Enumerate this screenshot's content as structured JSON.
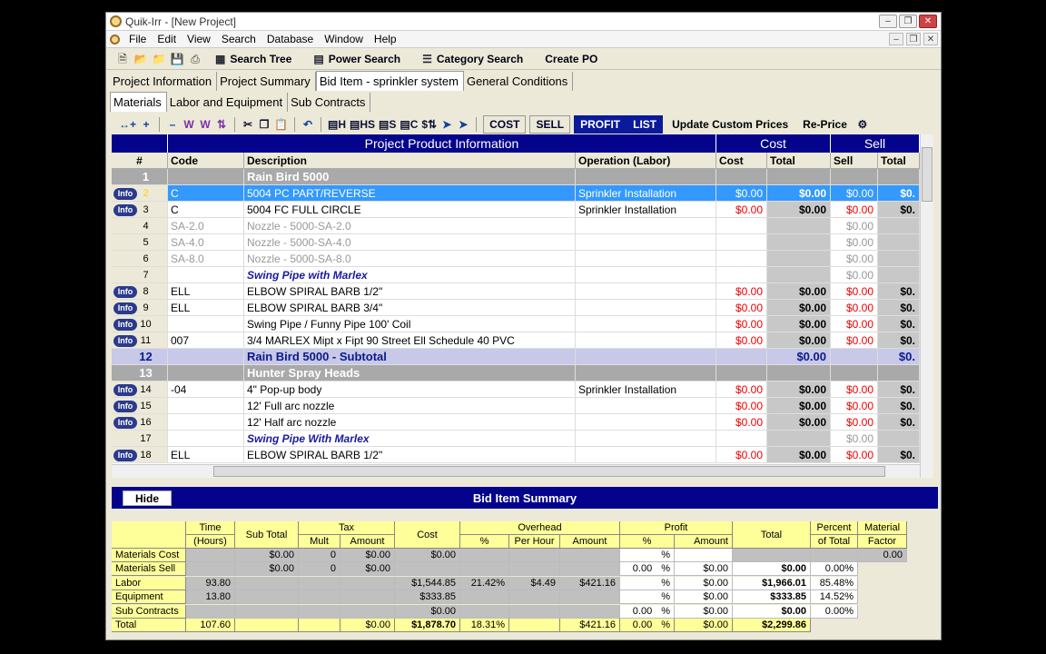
{
  "window": {
    "title": "Quik-Irr - [New Project]"
  },
  "menu": [
    "File",
    "Edit",
    "View",
    "Search",
    "Database",
    "Window",
    "Help"
  ],
  "toolbar": {
    "search_tree": "Search Tree",
    "power_search": "Power Search",
    "category_search": "Category Search",
    "create_po": "Create PO"
  },
  "tabs1": [
    "Project Information",
    "Project Summary",
    "Bid Item - sprinkler system",
    "General Conditions"
  ],
  "tabs2": [
    "Materials",
    "Labor and Equipment",
    "Sub Contracts"
  ],
  "toolbar2": {
    "cost": "COST",
    "sell": "SELL",
    "profit": "PROFIT",
    "list": "LIST",
    "update_prices": "Update Custom Prices",
    "reprice": "Re-Price",
    "h": "H",
    "hs": "HS",
    "s": "S",
    "c": "C"
  },
  "grid": {
    "group_headers": {
      "product": "Project Product Information",
      "cost": "Cost",
      "sell": "Sell"
    },
    "columns": {
      "num": "#",
      "code": "Code",
      "desc": "Description",
      "op": "Operation (Labor)",
      "cost": "Cost",
      "total": "Total",
      "sell": "Sell",
      "sell_total": "Total"
    },
    "info_label": "Info",
    "rows": [
      {
        "n": "1",
        "type": "group",
        "desc": "Rain Bird 5000"
      },
      {
        "n": "2",
        "type": "sel",
        "info": true,
        "code": "C",
        "desc": "5004 PC PART/REVERSE",
        "op": "Sprinkler Installation",
        "cost": "$0.00",
        "total": "$0.00",
        "sell": "$0.00",
        "stotal": "$0."
      },
      {
        "n": "3",
        "type": "item",
        "info": true,
        "code": "C",
        "desc": "5004 FC FULL CIRCLE",
        "op": "Sprinkler Installation",
        "cost": "$0.00",
        "total": "$0.00",
        "sell": "$0.00",
        "stotal": "$0."
      },
      {
        "n": "4",
        "type": "gray",
        "code": "SA-2.0",
        "desc": "Nozzle - 5000-SA-2.0",
        "sell": "$0.00"
      },
      {
        "n": "5",
        "type": "gray",
        "code": "SA-4.0",
        "desc": "Nozzle - 5000-SA-4.0",
        "sell": "$0.00"
      },
      {
        "n": "6",
        "type": "gray",
        "code": "SA-8.0",
        "desc": "Nozzle - 5000-SA-8.0",
        "sell": "$0.00"
      },
      {
        "n": "7",
        "type": "italic",
        "desc": "Swing Pipe with Marlex",
        "sell": "$0.00"
      },
      {
        "n": "8",
        "type": "item",
        "info": true,
        "code": "ELL",
        "desc": "ELBOW SPIRAL BARB 1/2\"",
        "cost": "$0.00",
        "total": "$0.00",
        "sell": "$0.00",
        "stotal": "$0."
      },
      {
        "n": "9",
        "type": "item",
        "info": true,
        "code": "ELL",
        "desc": "ELBOW SPIRAL BARB 3/4\"",
        "cost": "$0.00",
        "total": "$0.00",
        "sell": "$0.00",
        "stotal": "$0."
      },
      {
        "n": "10",
        "type": "item",
        "info": true,
        "code": "",
        "desc": "Swing Pipe / Funny Pipe 100' Coil",
        "cost": "$0.00",
        "total": "$0.00",
        "sell": "$0.00",
        "stotal": "$0."
      },
      {
        "n": "11",
        "type": "item",
        "info": true,
        "code": "007",
        "desc": "3/4 MARLEX Mipt x Fipt 90 Street Ell Schedule 40 PVC",
        "cost": "$0.00",
        "total": "$0.00",
        "sell": "$0.00",
        "stotal": "$0."
      },
      {
        "n": "12",
        "type": "sub",
        "desc": "Rain Bird 5000 - Subtotal",
        "total": "$0.00",
        "stotal": "$0."
      },
      {
        "n": "13",
        "type": "group",
        "desc": "Hunter Spray Heads"
      },
      {
        "n": "14",
        "type": "item",
        "info": true,
        "code": "-04",
        "desc": "4\" Pop-up body",
        "op": "Sprinkler Installation",
        "cost": "$0.00",
        "total": "$0.00",
        "sell": "$0.00",
        "stotal": "$0."
      },
      {
        "n": "15",
        "type": "item",
        "info": true,
        "code": "",
        "desc": "12' Full arc nozzle",
        "cost": "$0.00",
        "total": "$0.00",
        "sell": "$0.00",
        "stotal": "$0."
      },
      {
        "n": "16",
        "type": "item",
        "info": true,
        "code": "",
        "desc": "12' Half  arc nozzle",
        "cost": "$0.00",
        "total": "$0.00",
        "sell": "$0.00",
        "stotal": "$0."
      },
      {
        "n": "17",
        "type": "italic",
        "desc": "Swing Pipe With Marlex",
        "sell": "$0.00"
      },
      {
        "n": "18",
        "type": "item",
        "info": true,
        "code": "ELL",
        "desc": "ELBOW SPIRAL BARB 1/2\"",
        "cost": "$0.00",
        "total": "$0.00",
        "sell": "$0.00",
        "stotal": "$0."
      }
    ]
  },
  "summary": {
    "title": "Bid Item Summary",
    "hide": "Hide",
    "headers": {
      "time": "Time",
      "hours": "(Hours)",
      "subtotal": "Sub Total",
      "tax": "Tax",
      "mult": "Mult",
      "amount": "Amount",
      "cost": "Cost",
      "overhead": "Overhead",
      "pct": "%",
      "perhour": "Per Hour",
      "oamount": "Amount",
      "profit": "Profit",
      "ppct": "%",
      "pamount": "Amount",
      "total": "Total",
      "pot": "Percent",
      "pot2": "of Total",
      "mf": "Material",
      "mf2": "Factor"
    },
    "rows": [
      {
        "label": "Materials Cost",
        "subtotal": "$0.00",
        "mult": "0",
        "tamt": "$0.00",
        "cost": "$0.00",
        "mf": "0.00"
      },
      {
        "label": "Materials Sell",
        "subtotal": "$0.00",
        "mult": "0",
        "tamt": "$0.00",
        "ppct": "0.00",
        "pamt": "$0.00",
        "total": "$0.00",
        "pot": "0.00%"
      },
      {
        "label": "Labor",
        "time": "93.80",
        "cost": "$1,544.85",
        "opct": "21.42%",
        "ph": "$4.49",
        "oamt": "$421.16",
        "pamt": "$0.00",
        "total": "$1,966.01",
        "pot": "85.48%"
      },
      {
        "label": "Equipment",
        "time": "13.80",
        "cost": "$333.85",
        "pamt": "$0.00",
        "total": "$333.85",
        "pot": "14.52%"
      },
      {
        "label": "Sub Contracts",
        "cost": "$0.00",
        "ppct": "0.00",
        "pamt": "$0.00",
        "total": "$0.00",
        "pot": "0.00%"
      },
      {
        "label": "Total",
        "time": "107.60",
        "tamt": "$0.00",
        "cost": "$1,878.70",
        "opct": "18.31%",
        "oamt": "$421.16",
        "ppct": "0.00",
        "pamt": "$0.00",
        "total": "$2,299.86"
      }
    ],
    "pct_sign": "%"
  }
}
